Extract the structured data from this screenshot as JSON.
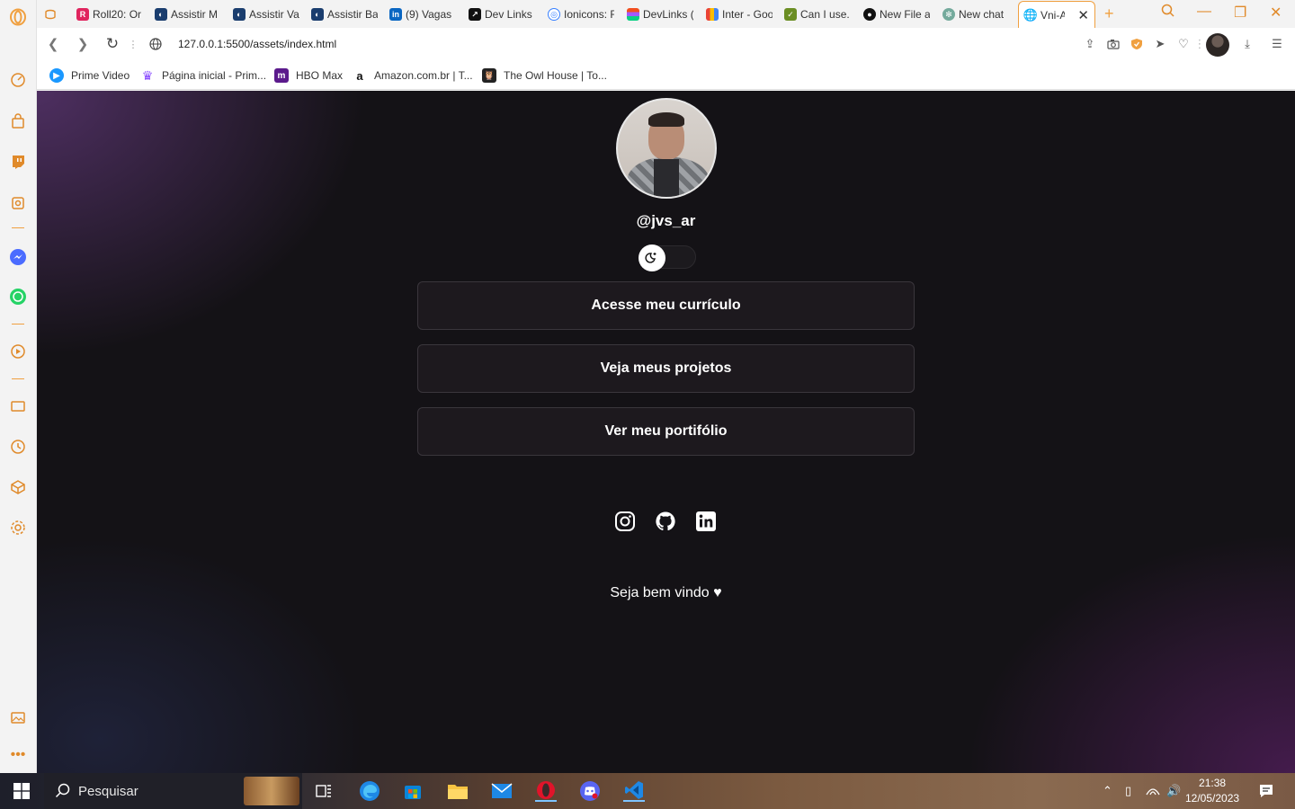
{
  "browser": {
    "tabs": [
      {
        "label": "Roll20: Or",
        "icon": "roll20-icon",
        "color": "#e0245e"
      },
      {
        "label": "Assistir M",
        "icon": "crunchyroll-icon",
        "color": "#1a3d6e"
      },
      {
        "label": "Assistir Va",
        "icon": "crunchyroll-icon",
        "color": "#1a3d6e"
      },
      {
        "label": "Assistir Ba",
        "icon": "crunchyroll-icon",
        "color": "#1a3d6e"
      },
      {
        "label": "(9) Vagas",
        "icon": "linkedin-icon",
        "color": "#0a66c2"
      },
      {
        "label": "Dev Links",
        "icon": "devlinks-icon",
        "color": "#111111"
      },
      {
        "label": "Ionicons: F",
        "icon": "ionicons-icon",
        "color": "#3880ff"
      },
      {
        "label": "DevLinks (",
        "icon": "figma-icon",
        "color": "#a259ff"
      },
      {
        "label": "Inter - Goo",
        "icon": "google-fonts-icon",
        "color": "#ea4335"
      },
      {
        "label": "Can I use.",
        "icon": "caniuse-icon",
        "color": "#6b8e23"
      },
      {
        "label": "New File a",
        "icon": "github-icon",
        "color": "#111111"
      },
      {
        "label": "New chat",
        "icon": "chatgpt-icon",
        "color": "#74aa9c"
      },
      {
        "label": "Vni-A",
        "icon": "globe-icon",
        "color": "#555555"
      }
    ],
    "url": "127.0.0.1:5500/assets/index.html",
    "bookmarks": [
      {
        "label": "Prime Video",
        "color": "#1a98ff"
      },
      {
        "label": "Página inicial - Prim...",
        "color": "#8a4bff"
      },
      {
        "label": "HBO Max",
        "color": "#5b1a8c"
      },
      {
        "label": "Amazon.com.br | T...",
        "color": "#ffffff"
      },
      {
        "label": "The Owl House | To...",
        "color": "#222222"
      }
    ],
    "accent": "#f0a040"
  },
  "page": {
    "username": "@jvs_ar",
    "buttons": [
      "Acesse meu currículo",
      "Veja meus projetos",
      "Ver meu portifólio"
    ],
    "social": [
      "instagram-icon",
      "github-icon",
      "linkedin-icon"
    ],
    "welcome": "Seja bem vindo ♥"
  },
  "taskbar": {
    "search_placeholder": "Pesquisar",
    "time": "21:38",
    "date": "12/05/2023"
  }
}
